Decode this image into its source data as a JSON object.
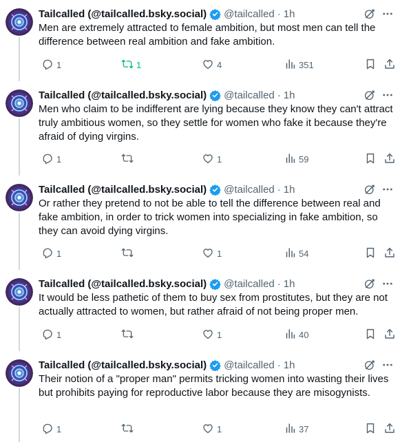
{
  "author": {
    "name": "Tailcalled (@tailcalled.bsky.social)",
    "handle": "@tailcalled",
    "separator": "·",
    "time": "1h"
  },
  "colors": {
    "verified": "#1d9bf0",
    "repost_active": "#00ba7c",
    "muted": "#536471",
    "text": "#0f1419",
    "thread_line": "#cfd9de"
  },
  "icons": [
    "verified-badge-icon",
    "grok-icon",
    "more-icon",
    "reply-icon",
    "repost-icon",
    "like-icon",
    "views-icon",
    "bookmark-icon",
    "share-icon"
  ],
  "tweets": [
    {
      "text": "Men are extremely attracted to female ambition, but most men can tell the difference between real ambition and fake ambition.",
      "replies": "1",
      "reposts": "1",
      "likes": "4",
      "views": "351",
      "reposted": true
    },
    {
      "text": "Men who claim to be indifferent are lying because they know they can't attract truly ambitious women, so they settle for women who fake it because they're afraid of dying virgins.",
      "replies": "1",
      "reposts": "",
      "likes": "1",
      "views": "59",
      "reposted": false
    },
    {
      "text": "Or rather they pretend to not be able to tell the difference between real and fake ambition, in order to trick women into specializing in fake ambition, so they can avoid dying virgins.",
      "replies": "1",
      "reposts": "",
      "likes": "1",
      "views": "54",
      "reposted": false
    },
    {
      "text": "It would be less pathetic of them to buy sex from prostitutes, but they are not actually attracted to women, but rather afraid of not being proper men.",
      "replies": "1",
      "reposts": "",
      "likes": "1",
      "views": "40",
      "reposted": false
    },
    {
      "text": "Their notion of a \"proper man\" permits tricking women into wasting their lives but prohibits paying for reproductive labor because they are misogynists.",
      "replies": "1",
      "reposts": "",
      "likes": "1",
      "views": "37",
      "reposted": false
    }
  ]
}
